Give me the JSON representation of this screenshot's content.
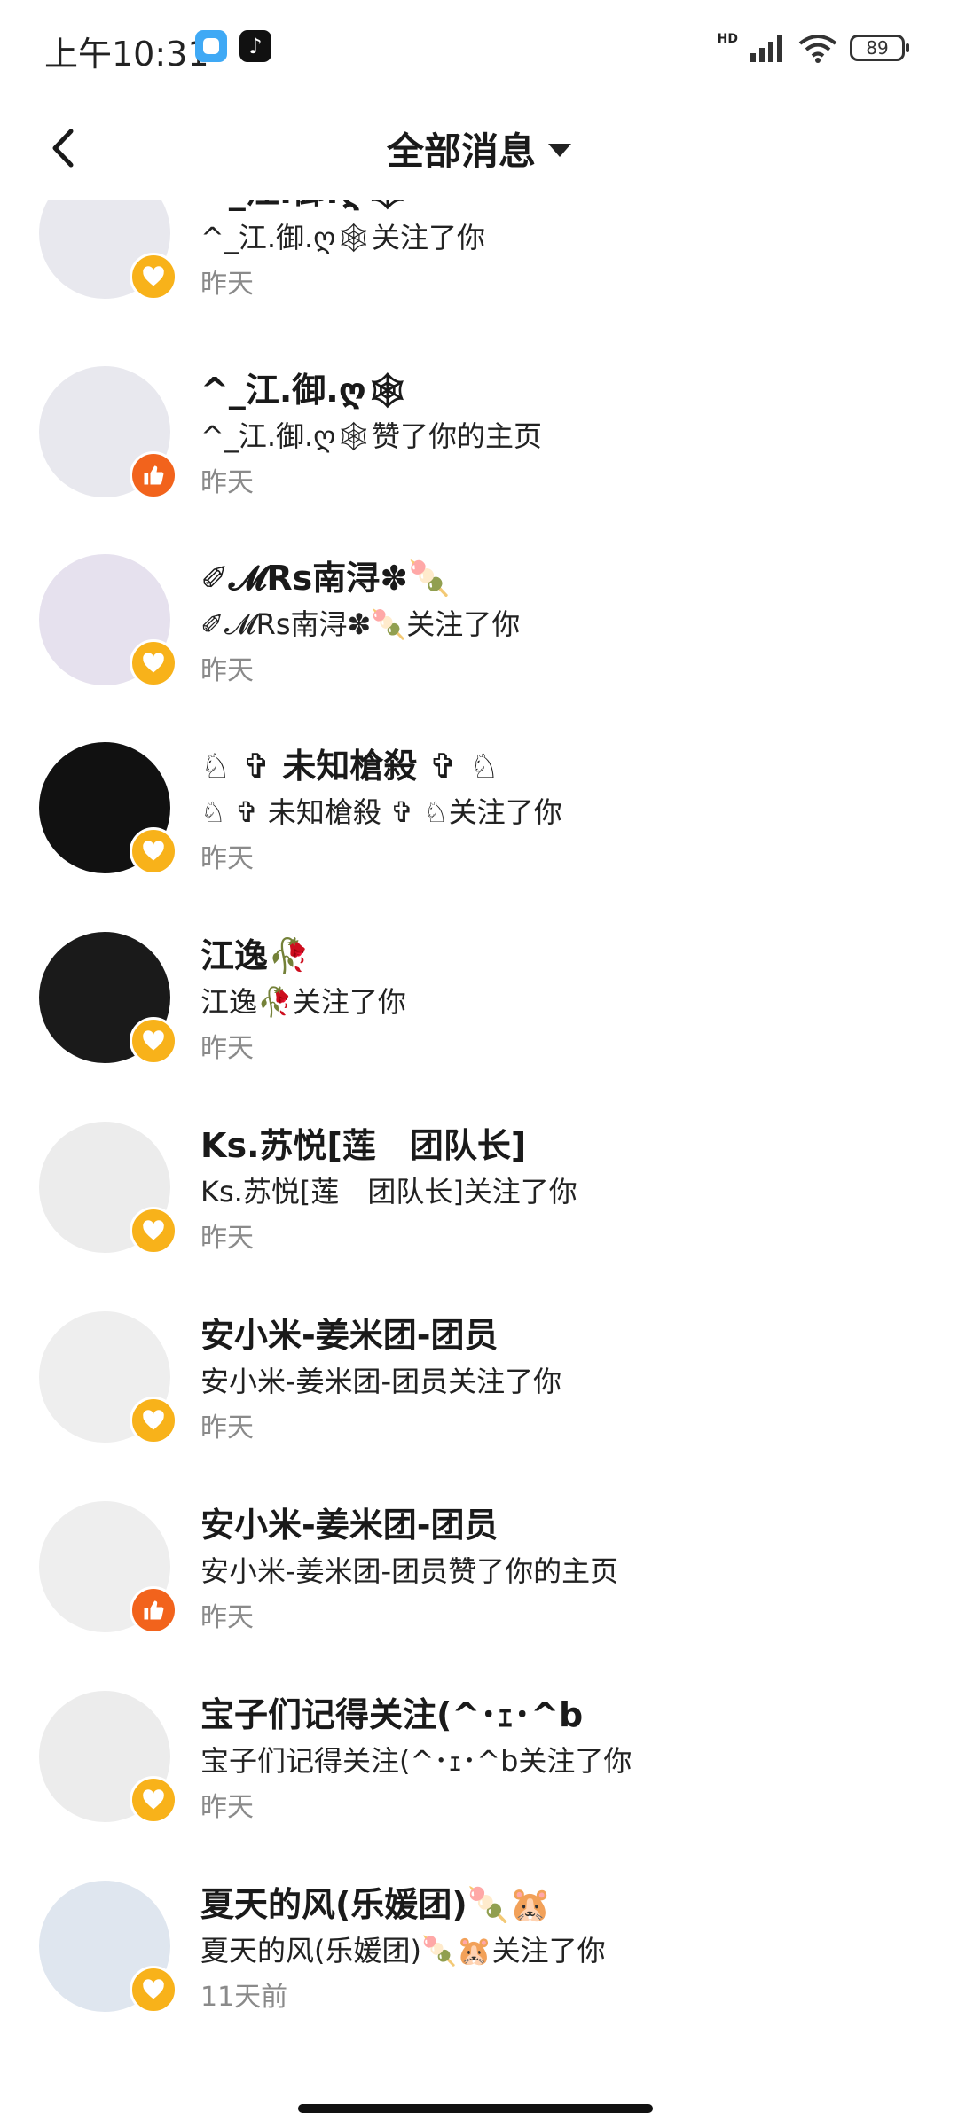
{
  "status_bar": {
    "time": "上午10:31",
    "network": "HD",
    "battery": "89",
    "app_icons": [
      "app-icon",
      "douyin-icon"
    ]
  },
  "header": {
    "back_icon": "back-arrow-icon",
    "title": "全部消息",
    "dropdown_icon": "caret-down-icon"
  },
  "messages": [
    {
      "name": "^_江.御.ღ🕸",
      "action": "^_江.御.ღ🕸关注了你",
      "time": "昨天",
      "badge": "follow",
      "avatar_color": "#e8e8ee"
    },
    {
      "name": "^_江.御.ღ🕸",
      "action": "^_江.御.ღ🕸赞了你的主页",
      "time": "昨天",
      "badge": "like",
      "avatar_color": "#e8e8ee"
    },
    {
      "name": "✐𝓜Rs南浔✽🍡",
      "action": "✐𝓜Rs南浔✽🍡关注了你",
      "time": "昨天",
      "badge": "follow",
      "avatar_color": "#e6e1ee"
    },
    {
      "name": "♘ ✞ 未知槍殺 ✞ ♘",
      "action": "♘ ✞ 未知槍殺 ✞ ♘关注了你",
      "time": "昨天",
      "badge": "follow",
      "avatar_color": "#111111"
    },
    {
      "name": "江逸🥀",
      "action": "江逸🥀关注了你",
      "time": "昨天",
      "badge": "follow",
      "avatar_color": "#1a1a1a"
    },
    {
      "name": "Ks.苏悦[莲　团队长]",
      "action": "Ks.苏悦[莲　团队长]关注了你",
      "time": "昨天",
      "badge": "follow",
      "avatar_color": "#ececec"
    },
    {
      "name": "安小米-姜米团-团员",
      "action": "安小米-姜米团-团员关注了你",
      "time": "昨天",
      "badge": "follow",
      "avatar_color": "#eeeeee"
    },
    {
      "name": "安小米-姜米团-团员",
      "action": "安小米-姜米团-团员赞了你的主页",
      "time": "昨天",
      "badge": "like",
      "avatar_color": "#eeeeee"
    },
    {
      "name": "宝子们记得关注(^･ｪ･^b",
      "action": "宝子们记得关注(^･ｪ･^b关注了你",
      "time": "昨天",
      "badge": "follow",
      "avatar_color": "#ececec"
    },
    {
      "name": "夏天的风(乐媛团)🍡🐹",
      "action": "夏天的风(乐媛团)🍡🐹关注了你",
      "time": "11天前",
      "badge": "follow",
      "avatar_color": "#dfe6ef"
    }
  ]
}
